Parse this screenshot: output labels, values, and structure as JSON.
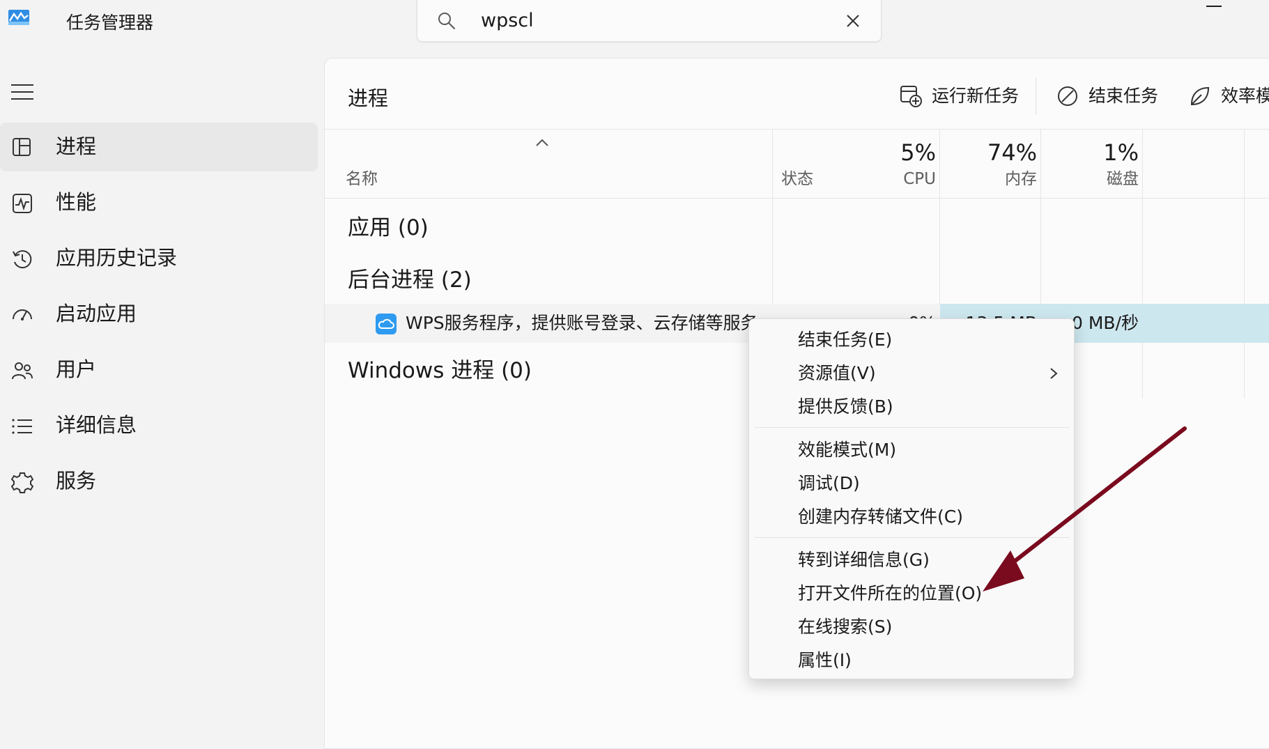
{
  "app": {
    "title": "任务管理器"
  },
  "search": {
    "value": "wpscl"
  },
  "sidebar": {
    "items": [
      {
        "label": "进程",
        "icon": "processes-icon",
        "active": true
      },
      {
        "label": "性能",
        "icon": "performance-icon"
      },
      {
        "label": "应用历史记录",
        "icon": "app-history-icon"
      },
      {
        "label": "启动应用",
        "icon": "startup-apps-icon"
      },
      {
        "label": "用户",
        "icon": "users-icon"
      },
      {
        "label": "详细信息",
        "icon": "details-icon"
      },
      {
        "label": "服务",
        "icon": "services-icon"
      }
    ]
  },
  "main": {
    "title": "进程",
    "toolbar": {
      "run_new_task": "运行新任务",
      "end_task": "结束任务",
      "efficiency_mode": "效率模"
    },
    "columns": {
      "name": "名称",
      "status": "状态",
      "cpu": {
        "percent": "5%",
        "label": "CPU"
      },
      "memory": {
        "percent": "74%",
        "label": "内存"
      },
      "disk": {
        "percent": "1%",
        "label": "磁盘"
      }
    },
    "groups": {
      "apps": "应用 (0)",
      "background": "后台进程 (2)",
      "windows": "Windows 进程 (0)"
    },
    "process": {
      "name": "WPS服务程序，提供账号登录、云存储等服务",
      "cpu": "0%",
      "memory": "13.5 MB",
      "disk": "0 MB/秒"
    }
  },
  "context_menu": {
    "items": [
      "结束任务(E)",
      "资源值(V)",
      "提供反馈(B)",
      "效能模式(M)",
      "调试(D)",
      "创建内存转储文件(C)",
      "转到详细信息(G)",
      "打开文件所在的位置(O)",
      "在线搜索(S)",
      "属性(I)"
    ]
  },
  "colors": {
    "highlight_row": "#cde7ef",
    "annotation_arrow": "#7a0a1e",
    "sidebar_active": "#e8e8e8"
  }
}
